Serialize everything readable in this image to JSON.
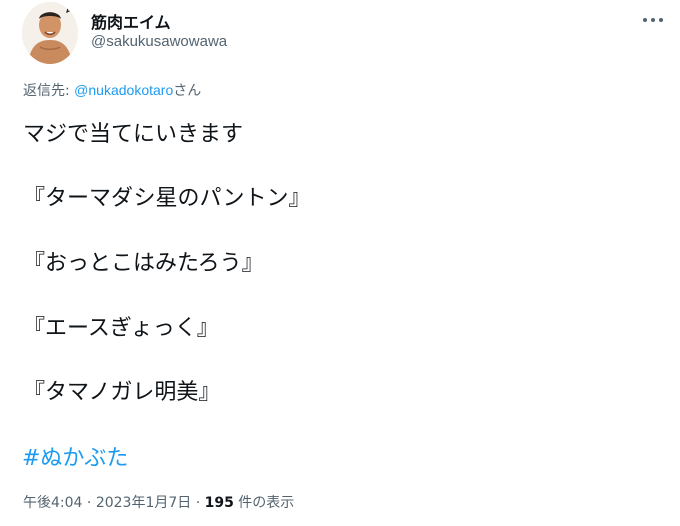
{
  "author": {
    "name": "筋肉エイム",
    "handle": "@sakukusawowawa"
  },
  "reply": {
    "prefix": "返信先: ",
    "mention": "@nukadokotaro",
    "suffix": "さん"
  },
  "tweet": {
    "lines": [
      "マジで当てにいきます",
      "『ターマダシ星のパントン』",
      "『おっとこはみたろう』",
      "『エースぎょっく』",
      "『タマノガレ明美』"
    ],
    "hashtag": "#ぬかぶた"
  },
  "meta": {
    "time": "午後4:04",
    "sep1": " · ",
    "date": "2023年1月7日",
    "sep2": " · ",
    "views": "195",
    "views_label": " 件の表示"
  },
  "colors": {
    "link": "#1d9bf0",
    "secondary": "#536471",
    "text": "#0f1419"
  }
}
